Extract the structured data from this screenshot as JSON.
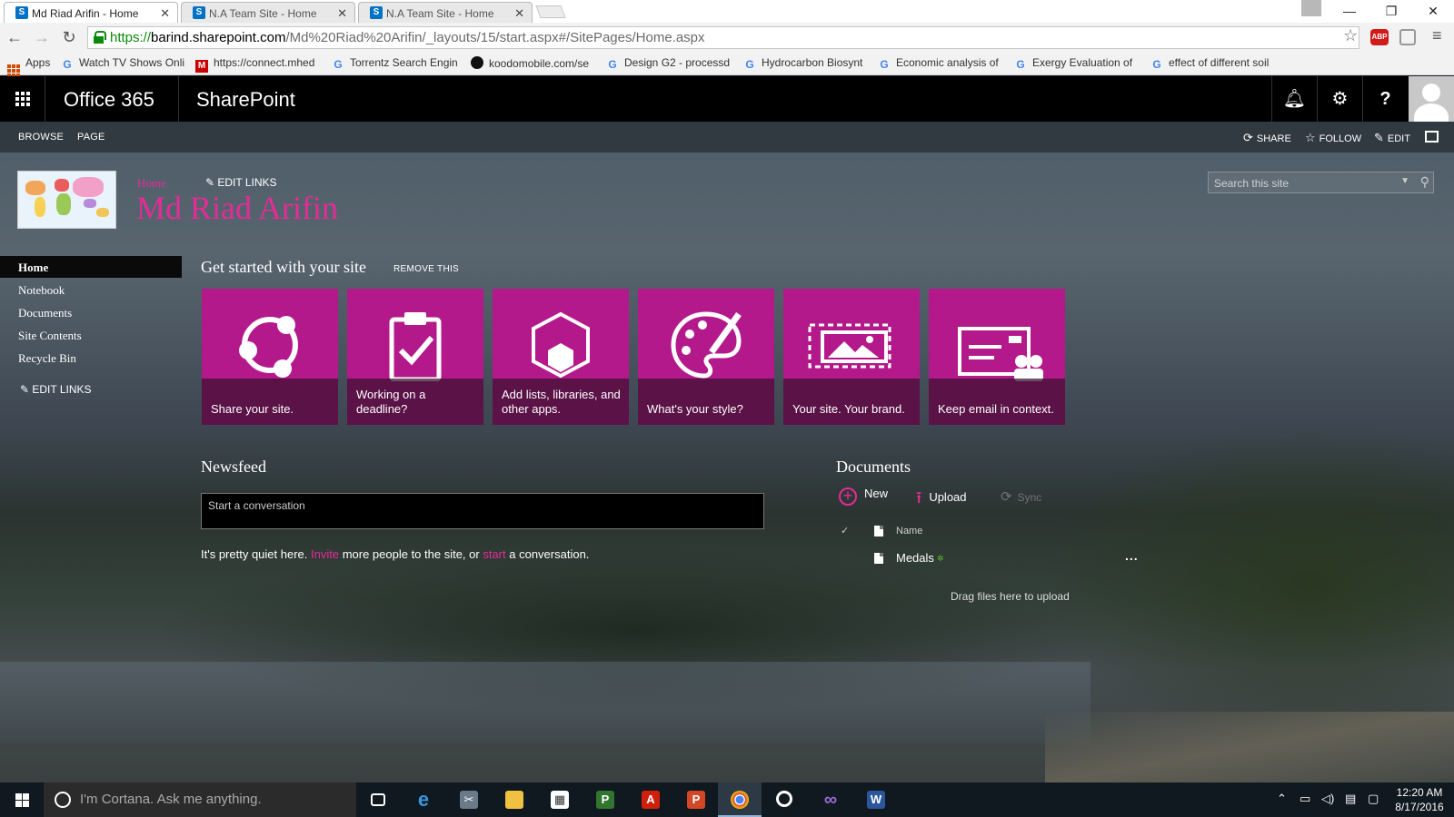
{
  "browser": {
    "tabs": [
      {
        "title": "Md Riad Arifin - Home",
        "favicon": "sharepoint-icon"
      },
      {
        "title": "N.A Team Site - Home",
        "favicon": "sharepoint-icon"
      },
      {
        "title": "N.A Team Site - Home",
        "favicon": "sharepoint-icon"
      }
    ],
    "url": {
      "protocol": "https://",
      "domain": "barind.sharepoint.com",
      "path": "/Md%20Riad%20Arifin/_layouts/15/start.aspx#/SitePages/Home.aspx"
    },
    "abp_label": "ABP",
    "bookmarks": [
      {
        "label": "Apps",
        "icon": "apps-icon"
      },
      {
        "label": "Watch TV Shows Onli",
        "icon": "google-icon"
      },
      {
        "label": "https://connect.mhed",
        "icon": "mcgraw-icon"
      },
      {
        "label": "Torrentz Search Engin",
        "icon": "google-icon"
      },
      {
        "label": "koodomobile.com/se",
        "icon": "koodo-icon"
      },
      {
        "label": "Design G2 - processd",
        "icon": "google-icon"
      },
      {
        "label": "Hydrocarbon Biosynt",
        "icon": "google-icon"
      },
      {
        "label": "Economic analysis of",
        "icon": "google-icon"
      },
      {
        "label": "Exergy Evaluation of",
        "icon": "google-icon"
      },
      {
        "label": "effect of different soil",
        "icon": "google-icon"
      }
    ]
  },
  "suitebar": {
    "brand": "Office 365",
    "app": "SharePoint",
    "icons": [
      "bell-icon",
      "gear-icon",
      "help-icon",
      "user-avatar"
    ]
  },
  "ribbon": {
    "tabs": [
      "BROWSE",
      "PAGE"
    ],
    "actions": [
      {
        "label": "SHARE",
        "icon": "share-icon"
      },
      {
        "label": "FOLLOW",
        "icon": "star-icon"
      },
      {
        "label": "EDIT",
        "icon": "pencil-icon"
      }
    ]
  },
  "site": {
    "breadcrumb": "Home",
    "edit_links": "EDIT LINKS",
    "title": "Md Riad Arifin",
    "search_placeholder": "Search this site"
  },
  "quick_launch": {
    "items": [
      "Home",
      "Notebook",
      "Documents",
      "Site Contents",
      "Recycle Bin"
    ],
    "active": "Home",
    "edit_links": "EDIT LINKS"
  },
  "get_started": {
    "title": "Get started with your site",
    "remove": "REMOVE THIS",
    "tiles": [
      {
        "label": "Share your site.",
        "icon": "share-circle-icon"
      },
      {
        "label": "Working on a deadline?",
        "icon": "clipboard-check-icon"
      },
      {
        "label": "Add lists, libraries, and other apps.",
        "icon": "hexagon-apps-icon"
      },
      {
        "label": "What's your style?",
        "icon": "palette-icon"
      },
      {
        "label": "Your site. Your brand.",
        "icon": "image-frame-icon"
      },
      {
        "label": "Keep email in context.",
        "icon": "email-group-icon"
      }
    ],
    "accent": "#b4198c"
  },
  "newsfeed": {
    "title": "Newsfeed",
    "placeholder": "Start a conversation",
    "quiet_pre": "It's pretty quiet here. ",
    "invite": "Invite",
    "quiet_mid": " more people to the site, or ",
    "start": "start",
    "quiet_post": " a conversation."
  },
  "documents": {
    "title": "Documents",
    "new": "New",
    "upload": "Upload",
    "sync": "Sync",
    "column_name": "Name",
    "rows": [
      {
        "name": "Medals",
        "new_marker": "✲"
      }
    ],
    "row_menu": "...",
    "drag_hint": "Drag files here to upload"
  },
  "taskbar": {
    "cortana": "I'm Cortana. Ask me anything.",
    "apps": [
      "task-view-icon",
      "edge-icon",
      "snipping-tool-icon",
      "file-explorer-icon",
      "store-icon",
      "project-icon",
      "acrobat-icon",
      "powerpoint-icon",
      "chrome-icon",
      "media-icon",
      "visual-studio-icon",
      "word-icon"
    ],
    "time": "12:20 AM",
    "date": "8/17/2016"
  },
  "colors": {
    "accent_pink": "#e52b98",
    "suite_bar": "#000000"
  }
}
